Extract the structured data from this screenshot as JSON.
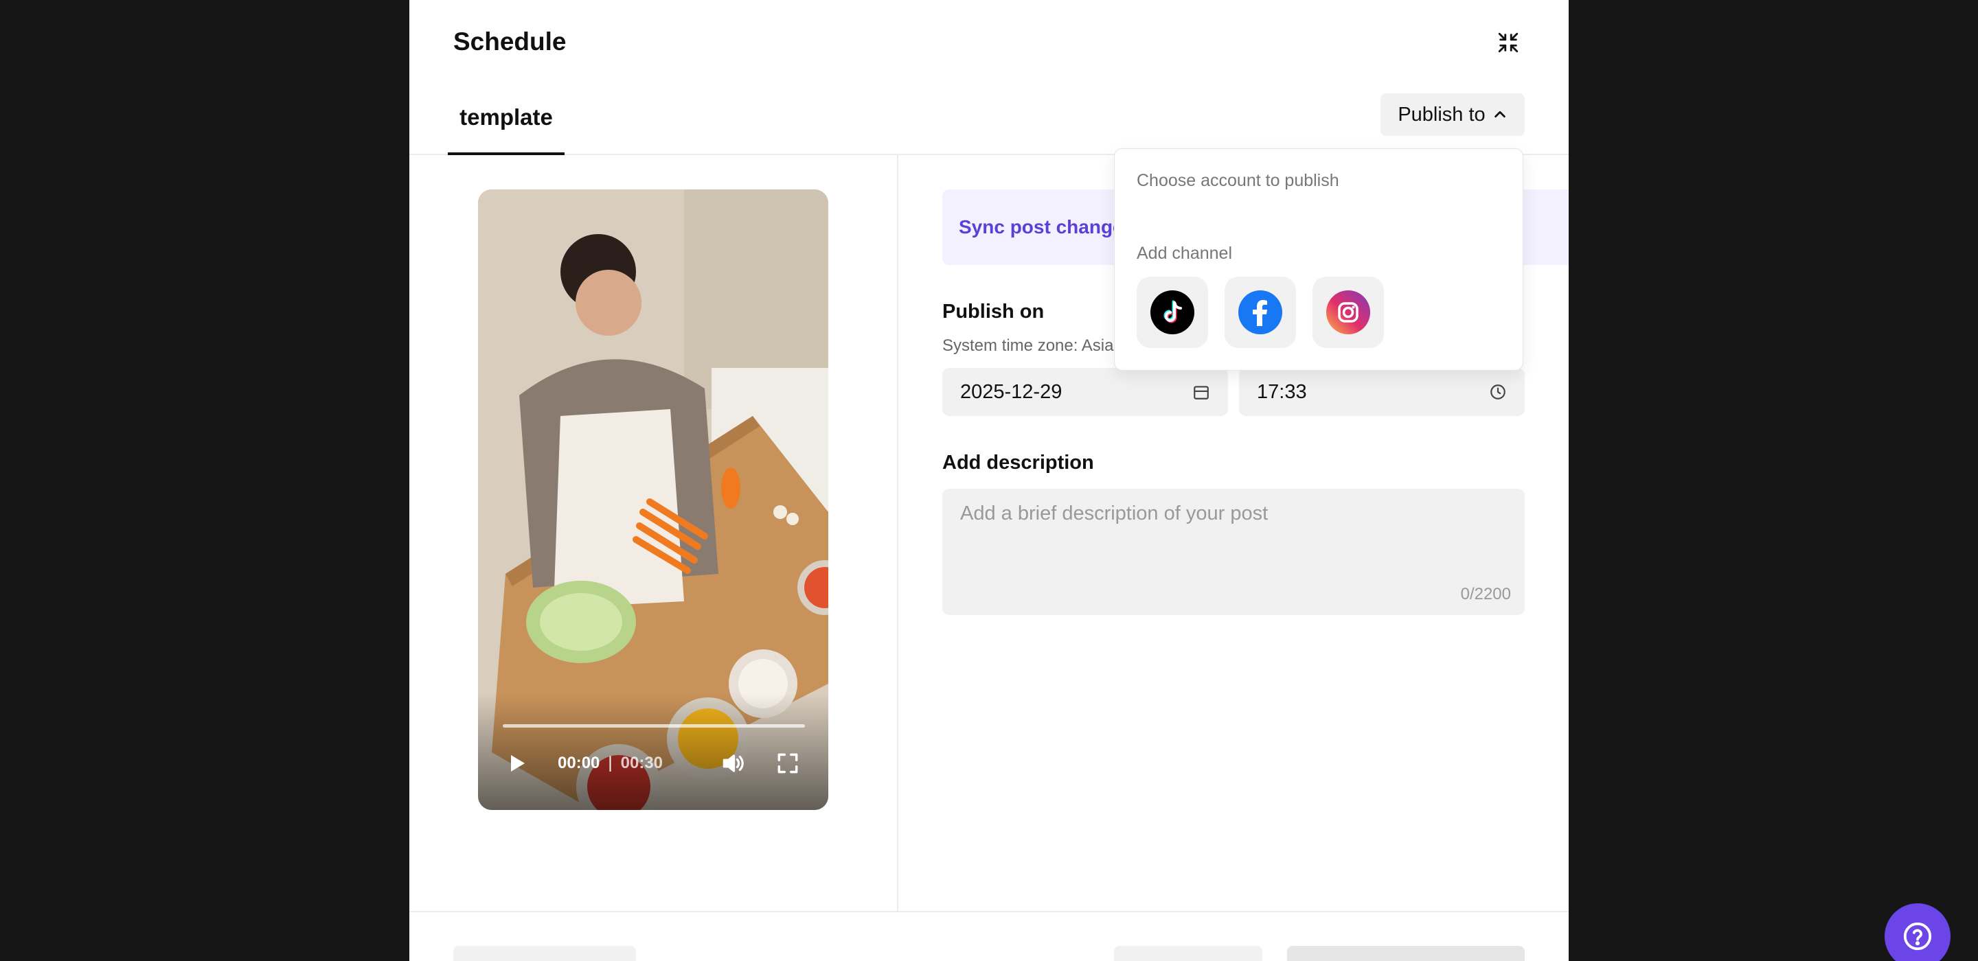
{
  "modal": {
    "title": "Schedule",
    "tab_label": "template",
    "publish_button": "Publish to"
  },
  "video": {
    "current_time": "00:00",
    "separator": "|",
    "duration": "00:30",
    "progress_fraction": 0
  },
  "form": {
    "sync_banner": "Sync post changes",
    "publish_on_label": "Publish on",
    "timezone_text": "System time zone: Asia",
    "date_value": "2025-12-29",
    "time_value": "17:33",
    "description_label": "Add description",
    "description_placeholder": "Add a brief description of your post",
    "description_counter": "0/2200"
  },
  "dropdown": {
    "choose_account": "Choose account to publish",
    "add_channel": "Add channel",
    "channels": [
      {
        "name": "TikTok",
        "icon": "tiktok-icon"
      },
      {
        "name": "Facebook",
        "icon": "facebook-icon"
      },
      {
        "name": "Instagram",
        "icon": "instagram-icon"
      }
    ]
  },
  "colors": {
    "accent": "#5b3fd6",
    "help_button": "#6b45e8",
    "facebook": "#1877f2"
  }
}
